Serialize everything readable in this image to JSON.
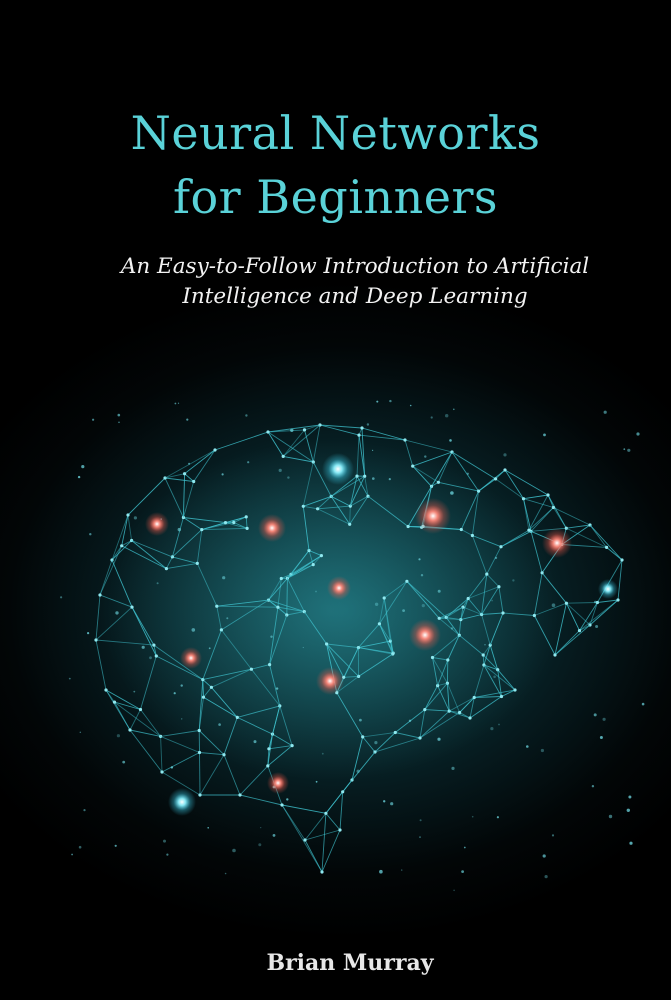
{
  "cover": {
    "title_line1": "Neural Networks",
    "title_line2": "for Beginners",
    "subtitle_line1": "An Easy-to-Follow Introduction to Artificial",
    "subtitle_line2": "Intelligence and Deep Learning",
    "author": "Brian Murray"
  },
  "colors": {
    "title": "#5ad2d8",
    "network_lines": "#3fc3cf",
    "node_red": "#ff6a5c",
    "node_cyan": "#53e6ff"
  },
  "illustration": {
    "icon": "brain-network-icon"
  }
}
